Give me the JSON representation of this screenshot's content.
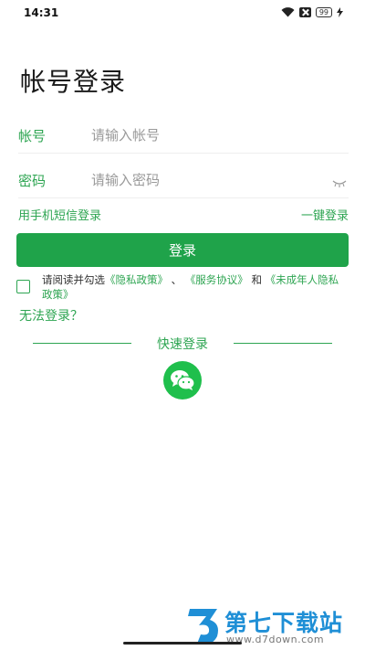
{
  "status_bar": {
    "time": "14:31",
    "battery": "99",
    "icons": [
      "wifi-icon",
      "sim-off-icon",
      "battery-icon",
      "charging-icon"
    ]
  },
  "title": "帐号登录",
  "account_field": {
    "label": "帐号",
    "placeholder": "请输入帐号",
    "value": ""
  },
  "password_field": {
    "label": "密码",
    "placeholder": "请输入密码",
    "value": "",
    "toggle_icon": "eye-closed-icon"
  },
  "links": {
    "sms_login": "用手机短信登录",
    "one_click_login": "一键登录"
  },
  "login_button": "登录",
  "agreement": {
    "checked": false,
    "prefix": "请阅读并勾选",
    "privacy_policy": "《隐私政策》",
    "separator": "、",
    "service_agreement": "《服务协议》",
    "and": "和",
    "minor_privacy_policy": "《未成年人隐私政策》"
  },
  "cant_login": "无法登录？",
  "quick_login": {
    "title": "快速登录",
    "icon": "wechat-icon"
  },
  "watermark": {
    "name": "第七下载站",
    "url": "www.d7down.com"
  },
  "colors": {
    "accent": "#2ea552",
    "button": "#1fa34a",
    "wechat": "#1fbf4c",
    "watermark": "#1f8fd6"
  }
}
